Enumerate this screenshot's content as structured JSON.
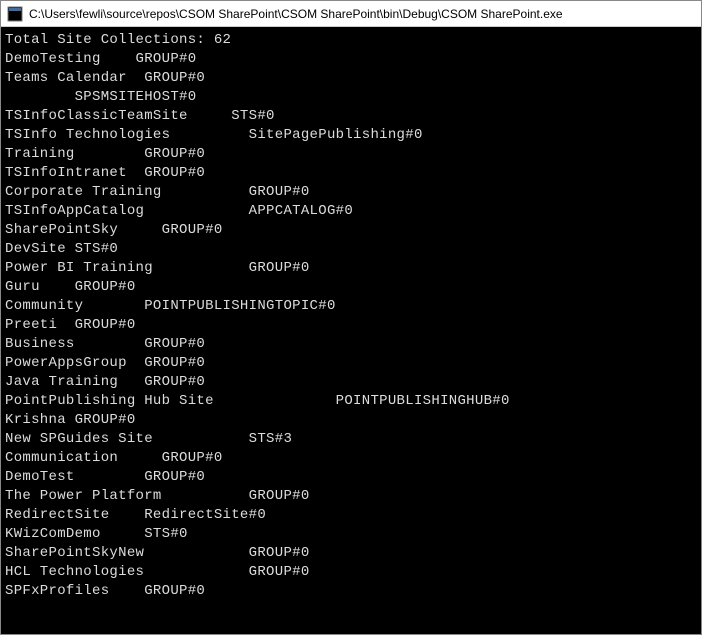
{
  "window": {
    "title": "C:\\Users\\fewli\\source\\repos\\CSOM SharePoint\\CSOM SharePoint\\bin\\Debug\\CSOM SharePoint.exe"
  },
  "console": {
    "totalLabel": "Total Site Collections:",
    "totalCount": "62",
    "rows": [
      {
        "name": "DemoTesting",
        "template": "GROUP#0",
        "col2": 15
      },
      {
        "name": "Teams Calendar",
        "template": "GROUP#0",
        "col2": 16
      },
      {
        "name": "",
        "template": "SPSMSITEHOST#0",
        "col2": 8
      },
      {
        "name": "TSInfoClassicTeamSite",
        "template": "STS#0",
        "col2": 26
      },
      {
        "name": "TSInfo Technologies",
        "template": "SitePagePublishing#0",
        "col2": 28
      },
      {
        "name": "Training",
        "template": "GROUP#0",
        "col2": 16
      },
      {
        "name": "TSInfoIntranet",
        "template": "GROUP#0",
        "col2": 16
      },
      {
        "name": "Corporate Training",
        "template": "GROUP#0",
        "col2": 28
      },
      {
        "name": "TSInfoAppCatalog",
        "template": "APPCATALOG#0",
        "col2": 28
      },
      {
        "name": "SharePointSky",
        "template": "GROUP#0",
        "col2": 18
      },
      {
        "name": "DevSite",
        "template": "STS#0",
        "col2": 8
      },
      {
        "name": "Power BI Training",
        "template": "GROUP#0",
        "col2": 28
      },
      {
        "name": "Guru",
        "template": "GROUP#0",
        "col2": 8
      },
      {
        "name": "Community",
        "template": "POINTPUBLISHINGTOPIC#0",
        "col2": 16
      },
      {
        "name": "Preeti",
        "template": "GROUP#0",
        "col2": 8
      },
      {
        "name": "Business",
        "template": "GROUP#0",
        "col2": 16
      },
      {
        "name": "PowerAppsGroup",
        "template": "GROUP#0",
        "col2": 16
      },
      {
        "name": "Java Training",
        "template": "GROUP#0",
        "col2": 16
      },
      {
        "name": "PointPublishing Hub Site",
        "template": "POINTPUBLISHINGHUB#0",
        "col2": 38
      },
      {
        "name": "Krishna",
        "template": "GROUP#0",
        "col2": 8
      },
      {
        "name": "New SPGuides Site",
        "template": "STS#3",
        "col2": 28
      },
      {
        "name": "Communication",
        "template": "GROUP#0",
        "col2": 18
      },
      {
        "name": "DemoTest",
        "template": "GROUP#0",
        "col2": 16
      },
      {
        "name": "The Power Platform",
        "template": "GROUP#0",
        "col2": 28
      },
      {
        "name": "RedirectSite",
        "template": "RedirectSite#0",
        "col2": 16
      },
      {
        "name": "KWizComDemo",
        "template": "STS#0",
        "col2": 16
      },
      {
        "name": "SharePointSkyNew",
        "template": "GROUP#0",
        "col2": 28
      },
      {
        "name": "HCL Technologies",
        "template": "GROUP#0",
        "col2": 28
      },
      {
        "name": "SPFxProfiles",
        "template": "GROUP#0",
        "col2": 16
      }
    ]
  }
}
